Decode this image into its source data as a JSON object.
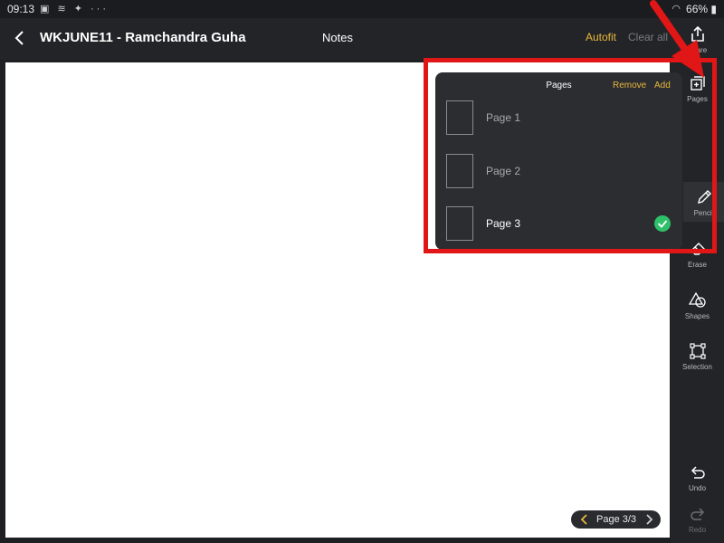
{
  "status_bar": {
    "time": "09:13",
    "notification_icons": "▣ ≋ ✦ ···",
    "battery": "66%",
    "wifi_icon": "wifi-icon"
  },
  "header": {
    "title": "WKJUNE11 - Ramchandra Guha",
    "mode": "Notes",
    "autofit": "Autofit",
    "clear_all": "Clear all"
  },
  "toolbar": {
    "share": "Share",
    "pages": "Pages",
    "pencil": "Pencil",
    "erase": "Erase",
    "shapes": "Shapes",
    "selection": "Selection",
    "undo": "Undo",
    "redo": "Redo"
  },
  "pages_popup": {
    "title": "Pages",
    "remove": "Remove",
    "add": "Add",
    "pages": [
      {
        "label": "Page 1"
      },
      {
        "label": "Page 2"
      },
      {
        "label": "Page 3",
        "selected": true
      }
    ]
  },
  "page_indicator": {
    "text": "Page 3/3"
  },
  "colors": {
    "accent": "#e8b83e",
    "check": "#2fc06a",
    "annotation": "#e11616"
  }
}
